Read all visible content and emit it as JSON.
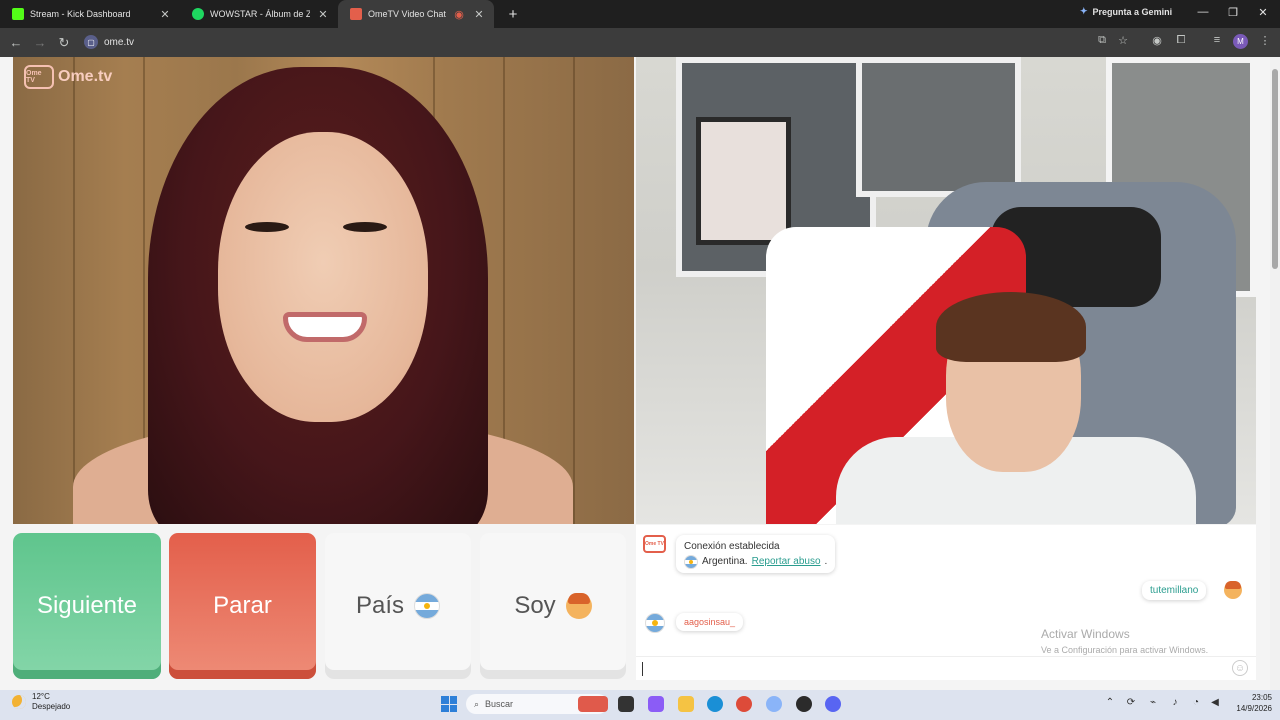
{
  "browser": {
    "tabs": [
      {
        "label": "Stream - Kick Dashboard",
        "color": "#53fc18"
      },
      {
        "label": "WOWSTAR - Álbum de Zell | Sp",
        "color": "#1ed760"
      },
      {
        "label": "OmeTV Video Chat — Ome",
        "color": "#e35f4b"
      }
    ],
    "new_tab_icon": "plus-icon",
    "gemini_label": "Pregunta a Gemini",
    "url": "ome.tv",
    "profile_initial": "M"
  },
  "page": {
    "logo_badge": "Ome TV",
    "logo_text": "Ome.tv",
    "buttons": {
      "next": "Siguiente",
      "stop": "Parar",
      "country": "País",
      "gender": "Soy"
    },
    "colors": {
      "next": "#5fc58d",
      "stop": "#e35f4b",
      "link": "#2a9d8f"
    }
  },
  "chat": {
    "system_icon_text": "Ome TV",
    "connection": "Conexión establecida",
    "country": "Argentina.",
    "report": "Reportar abuso",
    "report_suffix": ".",
    "me_name": "tutemillano",
    "peer_name": "aagosinsau_",
    "watermark_title": "Activar Windows",
    "watermark_sub": "Ve a Configuración para activar Windows."
  },
  "taskbar": {
    "temperature": "12°C",
    "weather": "Despejado",
    "search_placeholder": "Buscar",
    "time": "23:05",
    "date": "14/9/2026"
  }
}
